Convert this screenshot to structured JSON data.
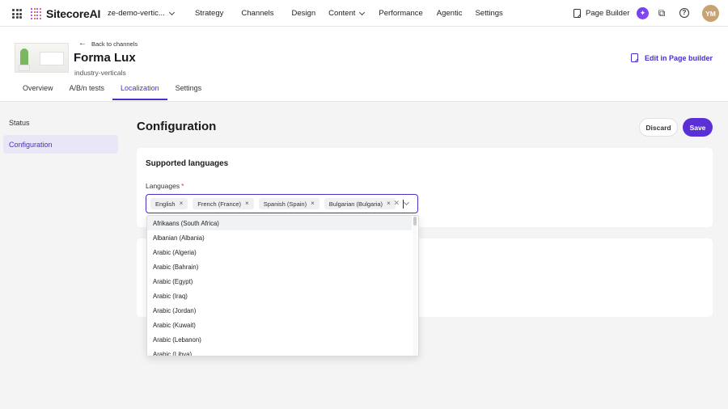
{
  "topbar": {
    "brand": "SitecoreAI",
    "site_picker": "ze-demo-vertic...",
    "nav": [
      "Strategy",
      "Channels",
      "Design",
      "Content",
      "Performance",
      "Agentic",
      "Settings"
    ],
    "page_builder": "Page Builder",
    "avatar_initials": "YM"
  },
  "header": {
    "back_label": "Back to channels",
    "title": "Forma Lux",
    "subtitle": "industry-verticals",
    "edit_button": "Edit in Page builder",
    "tabs": [
      "Overview",
      "A/B/n tests",
      "Localization",
      "Settings"
    ],
    "active_tab": "Localization"
  },
  "sidenav": {
    "items": [
      "Status",
      "Configuration"
    ],
    "active": "Configuration"
  },
  "content": {
    "title": "Configuration",
    "discard": "Discard",
    "save": "Save",
    "section_title": "Supported languages",
    "field_label": "Languages",
    "required_mark": "*",
    "selected": [
      "English",
      "French (France)",
      "Spanish (Spain)",
      "Bulgarian (Bulgaria)"
    ]
  },
  "dropdown": {
    "options": [
      "Afrikaans (South Africa)",
      "Albanian (Albania)",
      "Arabic (Algeria)",
      "Arabic (Bahrain)",
      "Arabic (Egypt)",
      "Arabic (Iraq)",
      "Arabic (Jordan)",
      "Arabic (Kuwait)",
      "Arabic (Lebanon)",
      "Arabic (Libya)"
    ]
  },
  "colors": {
    "accent": "#4a2fc9",
    "save_button": "#5a2fd6",
    "required": "#d9333f"
  },
  "icons": {
    "app_switcher": "grid-icon",
    "back": "arrow-left-icon",
    "page_builder": "document-edit-icon",
    "ai": "sparkle-icon",
    "extensions": "puzzle-icon",
    "help": "help-icon",
    "remove_chip": "close-icon",
    "dropdown": "chevron-down-icon"
  }
}
